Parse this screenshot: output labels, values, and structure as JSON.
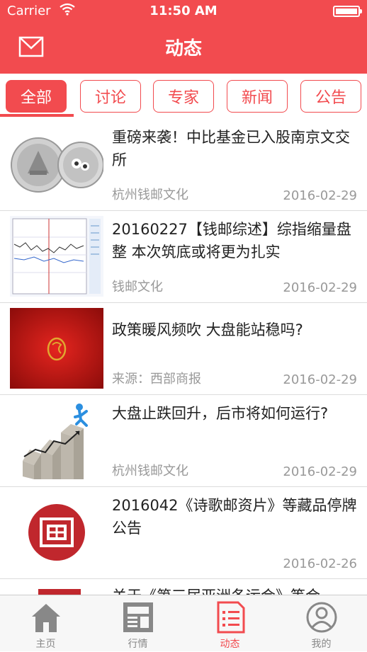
{
  "status_bar": {
    "carrier": "Carrier",
    "time": "11:50 AM"
  },
  "header": {
    "title": "动态",
    "mail_icon": "mail-icon"
  },
  "tabs": [
    {
      "label": "全部",
      "active": true
    },
    {
      "label": "讨论",
      "active": false
    },
    {
      "label": "专家",
      "active": false
    },
    {
      "label": "新闻",
      "active": false
    },
    {
      "label": "公告",
      "active": false
    }
  ],
  "news": [
    {
      "title": "重磅来袭！中比基金已入股南京文交所",
      "source": "杭州钱邮文化",
      "date": "2016-02-29",
      "thumb": "coins-image"
    },
    {
      "title": "20160227【钱邮综述】综指缩量盘整 本次筑底或将更为扎实",
      "source": "钱邮文化",
      "date": "2016-02-29",
      "thumb": "stock-chart-image"
    },
    {
      "title": "政策暖风频吹 大盘能站稳吗?",
      "source": "来源：西部商报",
      "date": "2016-02-29",
      "thumb": "red-seal-image"
    },
    {
      "title": "大盘止跌回升，后市将如何运行?",
      "source": "杭州钱邮文化",
      "date": "2016-02-29",
      "thumb": "climbing-figure-image"
    },
    {
      "title": "2016042《诗歌邮资片》等藏品停牌公告",
      "source": "",
      "date": "2016-02-26",
      "thumb": "red-stamp-logo"
    }
  ],
  "partial_item": {
    "title": "关于《第三届亚洲冬运会》等合"
  },
  "tabbar": [
    {
      "label": "主页",
      "icon": "home-icon",
      "active": false
    },
    {
      "label": "行情",
      "icon": "market-icon",
      "active": false
    },
    {
      "label": "动态",
      "icon": "news-icon",
      "active": true
    },
    {
      "label": "我的",
      "icon": "profile-icon",
      "active": false
    }
  ],
  "colors": {
    "accent": "#f24b4f"
  }
}
